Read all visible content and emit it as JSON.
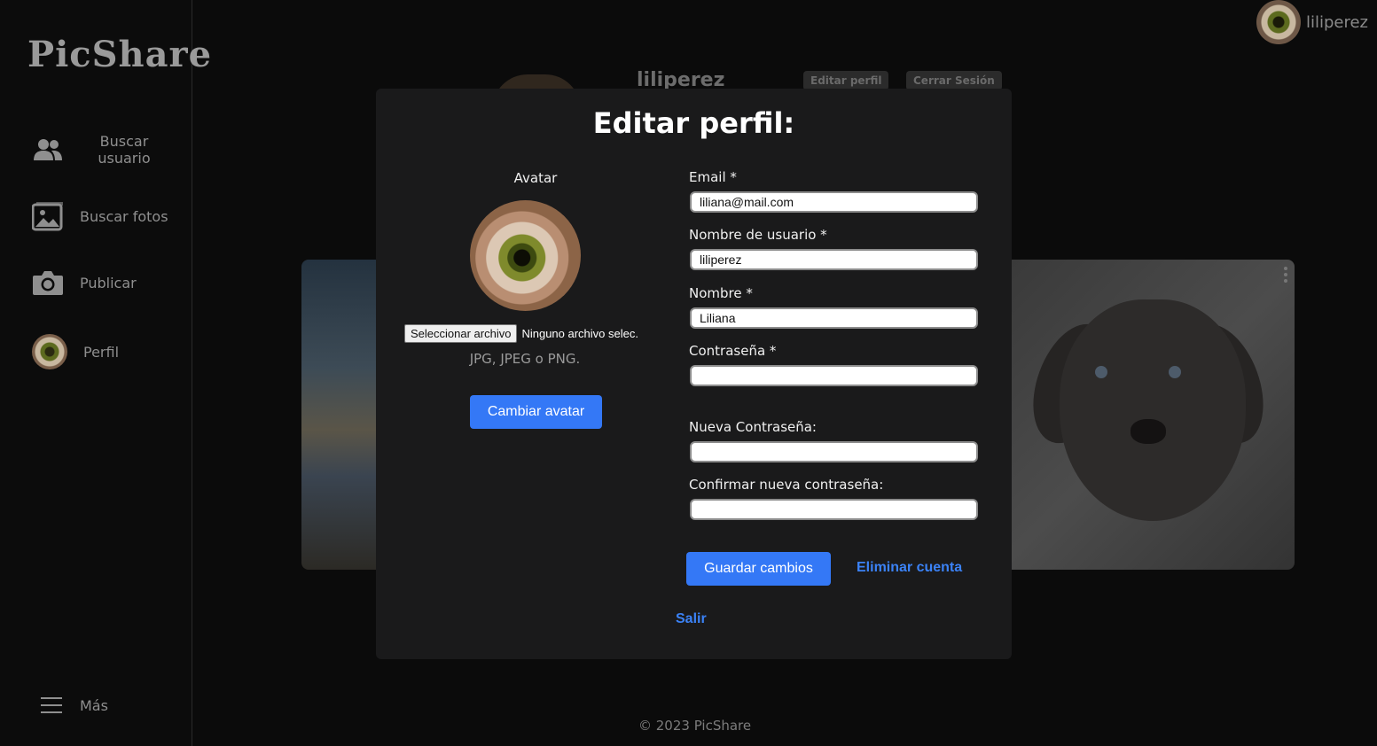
{
  "app": {
    "logo": "PicShare"
  },
  "sidebar": {
    "items": [
      {
        "label": "Buscar usuario",
        "icon": "users-icon"
      },
      {
        "label": "Buscar fotos",
        "icon": "images-icon"
      },
      {
        "label": "Publicar",
        "icon": "camera-icon"
      },
      {
        "label": "Perfil",
        "icon": "avatar"
      }
    ],
    "more_label": "Más"
  },
  "topbar": {
    "username": "liliperez"
  },
  "profile": {
    "username": "liliperez",
    "edit_button": "Editar perfil",
    "logout_button": "Cerrar Sesión"
  },
  "footer": {
    "text": "© 2023 PicShare"
  },
  "modal": {
    "title": "Editar perfil:",
    "avatar_label": "Avatar",
    "file_button": "Seleccionar archivo",
    "file_status": "Ninguno archivo selec.",
    "file_hint": "JPG, JPEG o PNG.",
    "change_avatar_button": "Cambiar avatar",
    "fields": {
      "email": {
        "label": "Email *",
        "value": "liliana@mail.com"
      },
      "username": {
        "label": "Nombre de usuario *",
        "value": "liliperez"
      },
      "name": {
        "label": "Nombre *",
        "value": "Liliana"
      },
      "password": {
        "label": "Contraseña *",
        "value": ""
      },
      "new_password": {
        "label": "Nueva Contraseña:",
        "value": ""
      },
      "confirm_password": {
        "label": "Confirmar nueva contraseña:",
        "value": ""
      }
    },
    "save_button": "Guardar cambios",
    "delete_link": "Eliminar cuenta",
    "exit_link": "Salir"
  },
  "colors": {
    "accent": "#3478f6",
    "link": "#3b82f6",
    "modal_bg": "#1a1a1b",
    "page_bg": "#0b0b0b"
  }
}
